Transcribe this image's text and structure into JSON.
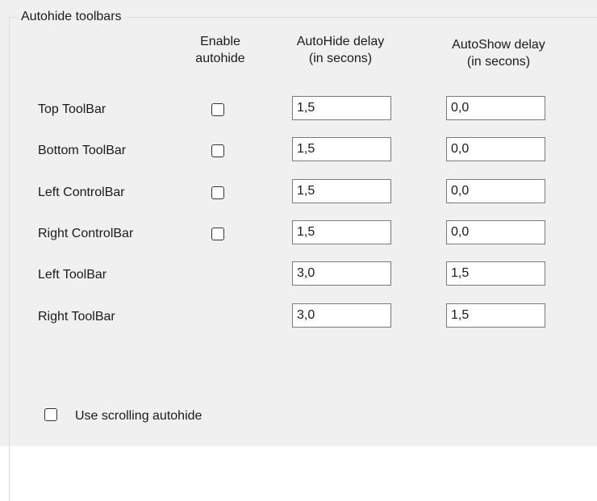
{
  "group": {
    "title": "Autohide toolbars"
  },
  "headers": {
    "enable": {
      "line1": "Enable",
      "line2": "autohide"
    },
    "autohide_delay": {
      "line1": "AutoHide delay",
      "line2": "(in secons)"
    },
    "autoshow_delay": {
      "line1": "AutoShow delay",
      "line2": "(in secons)"
    }
  },
  "rows": [
    {
      "label": "Top ToolBar",
      "enable": false,
      "has_checkbox": true,
      "autohide": "1,5",
      "autoshow": "0,0"
    },
    {
      "label": "Bottom ToolBar",
      "enable": false,
      "has_checkbox": true,
      "autohide": "1,5",
      "autoshow": "0,0"
    },
    {
      "label": "Left ControlBar",
      "enable": false,
      "has_checkbox": true,
      "autohide": "1,5",
      "autoshow": "0,0"
    },
    {
      "label": "Right ControlBar",
      "enable": false,
      "has_checkbox": true,
      "autohide": "1,5",
      "autoshow": "0,0"
    },
    {
      "label": "Left ToolBar",
      "has_checkbox": false,
      "autohide": "3,0",
      "autoshow": "1,5"
    },
    {
      "label": "Right ToolBar",
      "has_checkbox": false,
      "autohide": "3,0",
      "autoshow": "1,5"
    }
  ],
  "scrolling": {
    "label": "Use scrolling autohide",
    "checked": false
  },
  "colors": {
    "background": "#f0f0f0",
    "input_border": "#7a7a7a",
    "checkbox_border": "#333333",
    "group_border": "#dcdcdc"
  }
}
